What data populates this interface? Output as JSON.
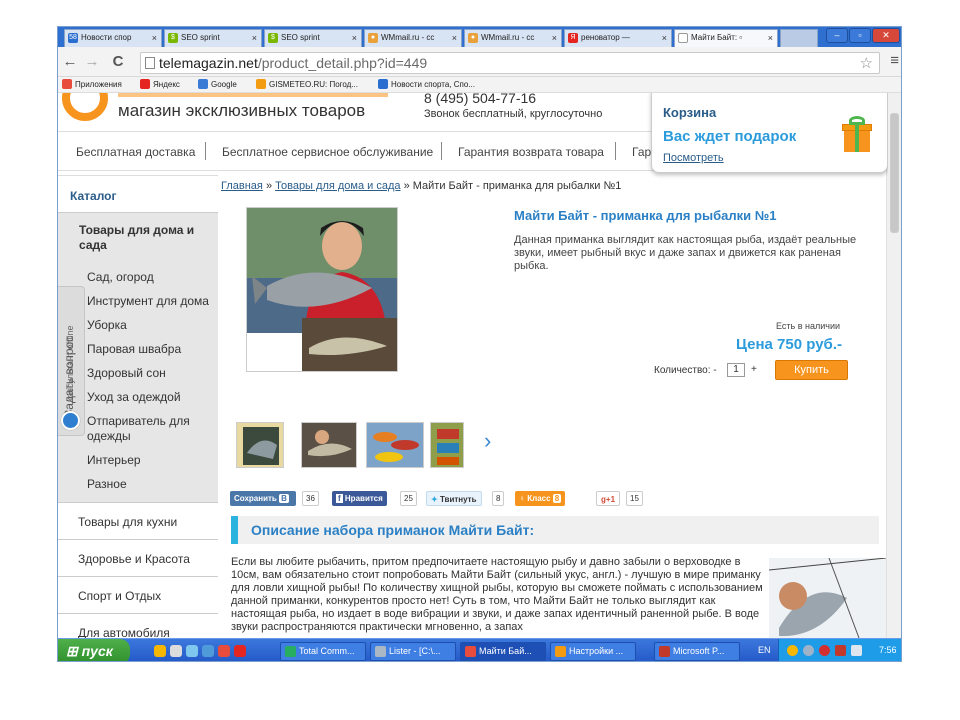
{
  "browser": {
    "tabs": [
      {
        "label": "Новости спор",
        "fav": "58",
        "fav_color": "#2a6fd0"
      },
      {
        "label": "SEO sprint",
        "fav": "$",
        "fav_color": "#7ab800"
      },
      {
        "label": "SEO sprint",
        "fav": "$",
        "fav_color": "#7ab800"
      },
      {
        "label": "WMmail.ru - сс",
        "fav": "●",
        "fav_color": "#e9a23b"
      },
      {
        "label": "WMmail.ru - сс",
        "fav": "●",
        "fav_color": "#e9a23b"
      },
      {
        "label": "реноватор —",
        "fav": "Я",
        "fav_color": "#e52620"
      },
      {
        "label": "Майти Байт: ▫",
        "fav": "",
        "fav_color": "#ffffff"
      }
    ],
    "tab_close": "×",
    "url_host": "telemagazin.net",
    "url_path": "/product_detail.php?id=449",
    "bookmarks": [
      {
        "label": "Приложения",
        "icon_color": "#e74c3c"
      },
      {
        "label": "Яндекс",
        "icon_color": "#e52620"
      },
      {
        "label": "Google",
        "icon_color": "#3a7bd5"
      },
      {
        "label": "GISMETEO.RU: Погод...",
        "icon_color": "#f39c12"
      },
      {
        "label": "Новости спорта, Спо...",
        "icon_color": "#2a6fd0"
      }
    ]
  },
  "header": {
    "tagline": "магазин эксклюзивных товаров",
    "phone": "8 (495) 504-77-16",
    "phone_note": "Звонок бесплатный, круглосуточно",
    "cart_title": "Корзина",
    "cart_gift": "Вас ждет подарок",
    "cart_link": "Посмотреть"
  },
  "topnav": [
    "Бесплатная доставка",
    "Бесплатное сервисное обслуживание",
    "Гарантия возврата товара",
    "Гар"
  ],
  "sidebar": {
    "title": "Каталог",
    "active_category": "Товары для дома и сада",
    "subcategories": [
      "Сад, огород",
      "Инструмент для дома",
      "Уборка",
      "Паровая швабра",
      "Здоровый сон",
      "Уход за одеждой",
      "Отпариватель для одежды",
      "Интерьер",
      "Разное"
    ],
    "categories": [
      "Товары для кухни",
      "Здоровье и Красота",
      "Спорт и Отдых",
      "Для автомобиля"
    ],
    "ask_title": "Задать вопрос",
    "ask_status": "консультант offline"
  },
  "breadcrumb": {
    "home": "Главная",
    "sep": "»",
    "category": "Товары для дома и сада",
    "current": "Майти Байт - приманка для рыбалки №1"
  },
  "product": {
    "title": "Майти Байт - приманка для рыбалки №1",
    "description": "Данная приманка выглядит как настоящая рыба, издаёт реальные звуки, имеет рыбный вкус и даже запах и движется как раненая рыбка.",
    "stock": "Есть в наличии",
    "price": "Цена 750 руб.-",
    "qty_label": "Количество:",
    "qty_minus": "-",
    "qty_value": "1",
    "qty_plus": "+",
    "buy_label": "Купить",
    "thumbs_next": "›"
  },
  "social": {
    "save": "Сохранить",
    "save_logo": "В",
    "save_count": "36",
    "fb": "Нравится",
    "fb_logo": "f",
    "fb_count": "25",
    "tw": "Твитнуть",
    "tw_count": "8",
    "ok": "Класс",
    "ok_count": "8",
    "gp": "+1",
    "gp_count": "15"
  },
  "description": {
    "heading": "Описание набора приманок Майти Байт:",
    "text": "Если вы любите рыбачить, притом предпочитаете настоящую рыбу и давно забыли о верховодке в 10см, вам обязательно стоит попробовать Майти Байт (сильный укус, англ.) - лучшую в мире приманку для ловли хищной рыбы! По количеству хищной рыбы, которую вы сможете поймать с использованием данной приманки, конкурентов просто нет! Суть в том, что Майти Байт не только выглядит как настоящая рыба, но издает в воде вибрации и звуки, и даже запах идентичный раненной рыбе. В воде звуки распространяются практически мгновенно, а запах"
  },
  "taskbar": {
    "start": "пуск",
    "tasks": [
      "Total Comm...",
      "Lister - [C:\\...",
      "Майти Бай...",
      "Настройки ...",
      "Microsoft P..."
    ],
    "task_icon_colors": [
      "#27ae60",
      "#aab7c4",
      "#e74c3c",
      "#f39c12",
      "#c0392b"
    ],
    "lang": "EN",
    "clock": "7:56"
  }
}
